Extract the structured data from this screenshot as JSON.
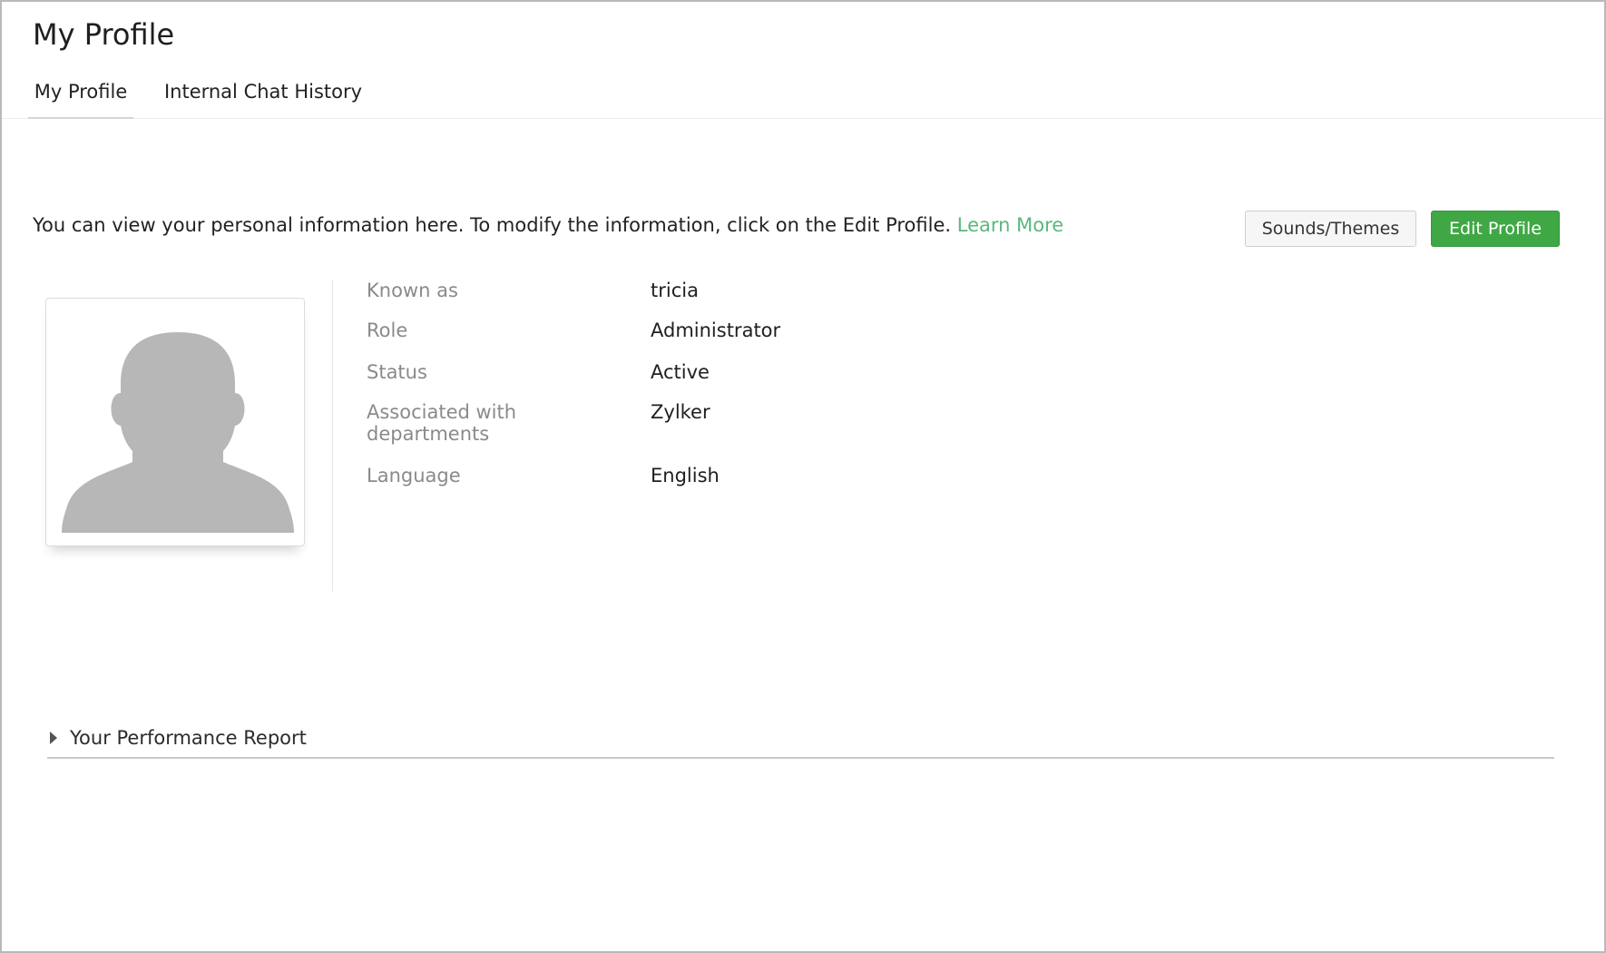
{
  "header": {
    "title": "My Profile"
  },
  "tabs": [
    {
      "label": "My Profile",
      "active": true
    },
    {
      "label": "Internal Chat History",
      "active": false
    }
  ],
  "intro": {
    "text": "You can view your personal information here. To modify the information, click on the Edit Profile. ",
    "link_label": "Learn More",
    "link_color": "#5ab87c"
  },
  "actions": {
    "sounds_label": "Sounds/Themes",
    "edit_label": "Edit Profile",
    "edit_color": "#3fa845"
  },
  "avatar": {
    "icon": "user-silhouette-icon"
  },
  "profile": {
    "fields": [
      {
        "label": "Known as",
        "value": "tricia"
      },
      {
        "label": "Role",
        "value": "Administrator"
      },
      {
        "label": "Status",
        "value": "Active"
      },
      {
        "label": "Associated with departments",
        "value": "Zylker"
      },
      {
        "label": "Language",
        "value": "English"
      }
    ]
  },
  "performance": {
    "label": "Your Performance Report",
    "expanded": false,
    "icon": "caret-right-icon"
  }
}
